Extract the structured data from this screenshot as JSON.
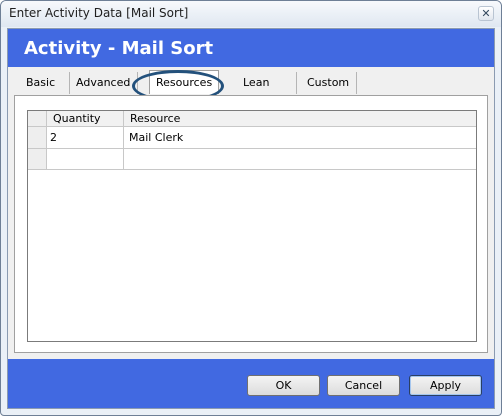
{
  "window": {
    "title": "Enter Activity Data [Mail Sort]",
    "close_glyph": "✕"
  },
  "header": {
    "title": "Activity - Mail Sort",
    "banner_color": "#4169E1"
  },
  "tabs": [
    {
      "label": "Basic",
      "active": false
    },
    {
      "label": "Advanced",
      "active": false
    },
    {
      "label": "Resources",
      "active": true
    },
    {
      "label": "Lean",
      "active": false
    },
    {
      "label": "Custom",
      "active": false
    }
  ],
  "grid": {
    "columns": [
      "Quantity",
      "Resource"
    ],
    "rows": [
      {
        "quantity": "2",
        "resource": "Mail Clerk"
      },
      {
        "quantity": "",
        "resource": ""
      }
    ]
  },
  "buttons": {
    "ok": "OK",
    "cancel": "Cancel",
    "apply": "Apply"
  }
}
